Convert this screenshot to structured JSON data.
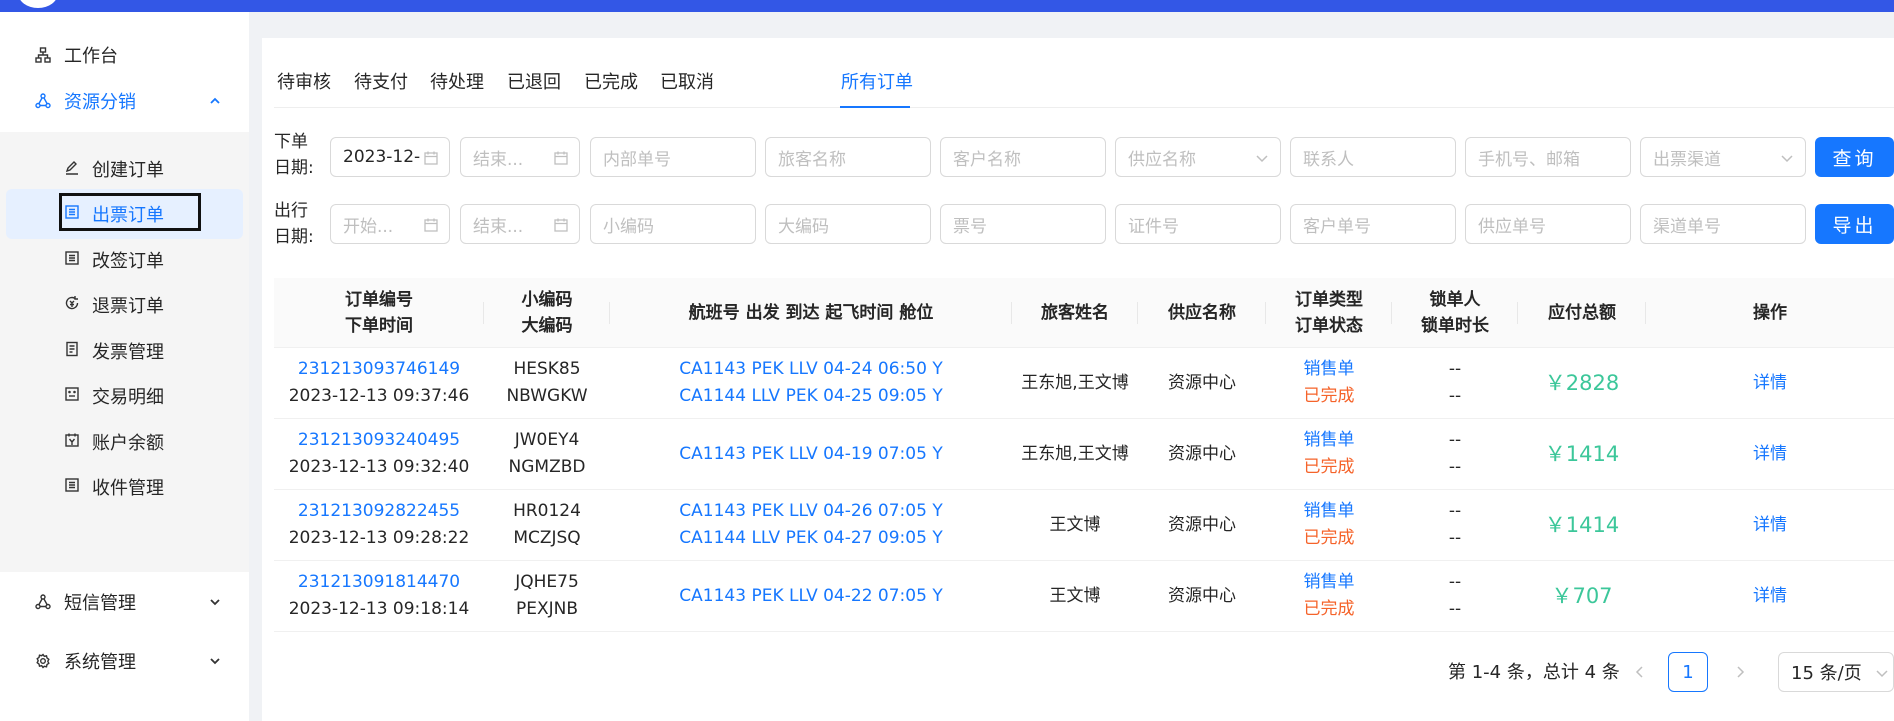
{
  "colors": {
    "primary": "#1677ff",
    "header": "#3357e6",
    "success_money": "#3cc79a",
    "completed": "#f5632a"
  },
  "sidebar": {
    "top_items": [
      {
        "label": "工作台",
        "icon": "sitemap-icon"
      },
      {
        "label": "资源分销",
        "icon": "share-nodes-icon",
        "expanded": true
      },
      {
        "label": "短信管理",
        "icon": "share-nodes-icon"
      },
      {
        "label": "系统管理",
        "icon": "gear-icon"
      }
    ],
    "sub_items": [
      {
        "label": "创建订单",
        "icon": "pencil-icon"
      },
      {
        "label": "出票订单",
        "icon": "list-doc-icon",
        "selected": true
      },
      {
        "label": "改签订单",
        "icon": "list-doc-icon"
      },
      {
        "label": "退票订单",
        "icon": "refund-icon"
      },
      {
        "label": "发票管理",
        "icon": "invoice-icon"
      },
      {
        "label": "交易明细",
        "icon": "face-doc-icon"
      },
      {
        "label": "账户余额",
        "icon": "wallet-icon"
      },
      {
        "label": "收件管理",
        "icon": "list-doc-icon"
      }
    ]
  },
  "tabs": [
    {
      "label": "待审核"
    },
    {
      "label": "待支付"
    },
    {
      "label": "待处理"
    },
    {
      "label": "已退回"
    },
    {
      "label": "已完成"
    },
    {
      "label": "已取消"
    },
    {
      "label": "所有订单",
      "active": true
    }
  ],
  "filters": {
    "order_date_label": "下单日期:",
    "travel_date_label": "出行日期:",
    "row1": {
      "order_start": "2023-12-",
      "order_end_placeholder": "结束...",
      "internal_no": "内部单号",
      "passenger_name": "旅客名称",
      "customer_name": "客户名称",
      "supplier_name": "供应名称",
      "contact": "联系人",
      "phone_email": "手机号、邮箱",
      "ticket_channel": "出票渠道"
    },
    "row2": {
      "travel_start_placeholder": "开始...",
      "travel_end_placeholder": "结束...",
      "small_code": "小编码",
      "big_code": "大编码",
      "ticket_no": "票号",
      "id_no": "证件号",
      "customer_no": "客户单号",
      "supplier_no": "供应单号",
      "channel_no": "渠道单号"
    },
    "query_button": "查询",
    "export_button": "导出"
  },
  "table": {
    "headers": {
      "order": [
        "订单编号",
        "下单时间"
      ],
      "code": [
        "小编码",
        "大编码"
      ],
      "flight": "航班号 出发 到达 起飞时间 舱位",
      "passenger": "旅客姓名",
      "supplier": "供应名称",
      "type": [
        "订单类型",
        "订单状态"
      ],
      "lock": [
        "锁单人",
        "锁单时长"
      ],
      "amount": "应付总额",
      "action": "操作"
    },
    "rows": [
      {
        "order_no": "231213093746149",
        "order_time": "2023-12-13 09:37:46",
        "small_code": "HESK85",
        "big_code": "NBWGKW",
        "flights": [
          "CA1143 PEK LLV 04-24 06:50 Y",
          "CA1144 LLV PEK 04-25 09:05 Y"
        ],
        "passenger": "王东旭,王文博",
        "supplier": "资源中心",
        "type": "销售单",
        "status": "已完成",
        "lock_user": "--",
        "lock_time": "--",
        "amount": "￥2828",
        "action": "详情"
      },
      {
        "order_no": "231213093240495",
        "order_time": "2023-12-13 09:32:40",
        "small_code": "JW0EY4",
        "big_code": "NGMZBD",
        "flights": [
          "CA1143 PEK LLV 04-19 07:05 Y"
        ],
        "passenger": "王东旭,王文博",
        "supplier": "资源中心",
        "type": "销售单",
        "status": "已完成",
        "lock_user": "--",
        "lock_time": "--",
        "amount": "￥1414",
        "action": "详情"
      },
      {
        "order_no": "231213092822455",
        "order_time": "2023-12-13 09:28:22",
        "small_code": "HR0124",
        "big_code": "MCZJSQ",
        "flights": [
          "CA1143 PEK LLV 04-26 07:05 Y",
          "CA1144 LLV PEK 04-27 09:05 Y"
        ],
        "passenger": "王文博",
        "supplier": "资源中心",
        "type": "销售单",
        "status": "已完成",
        "lock_user": "--",
        "lock_time": "--",
        "amount": "￥1414",
        "action": "详情"
      },
      {
        "order_no": "231213091814470",
        "order_time": "2023-12-13 09:18:14",
        "small_code": "JQHE75",
        "big_code": "PEXJNB",
        "flights": [
          "CA1143 PEK LLV 04-22 07:05 Y"
        ],
        "passenger": "王文博",
        "supplier": "资源中心",
        "type": "销售单",
        "status": "已完成",
        "lock_user": "--",
        "lock_time": "--",
        "amount": "￥707",
        "action": "详情"
      }
    ]
  },
  "pagination": {
    "summary": "第 1-4 条，总计 4 条",
    "current_page": "1",
    "page_size": "15 条/页"
  }
}
